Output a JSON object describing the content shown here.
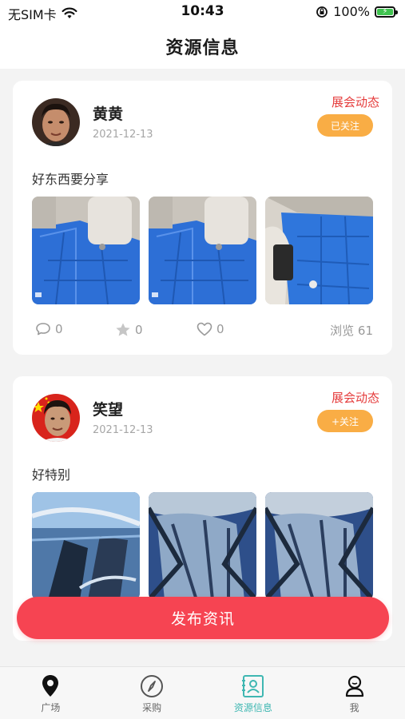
{
  "status_bar": {
    "carrier": "无SIM卡",
    "time": "10:43",
    "battery": "100%"
  },
  "nav": {
    "title": "资源信息"
  },
  "posts": [
    {
      "username": "黄黄",
      "date": "2021-12-13",
      "category": "展会动态",
      "follow_label": "已关注",
      "text": "好东西要分享",
      "comments": "0",
      "favorites": "0",
      "likes": "0",
      "views": "浏览 61"
    },
    {
      "username": "笑望",
      "date": "2021-12-13",
      "category": "展会动态",
      "follow_label": "+关注",
      "text": "好特别"
    }
  ],
  "publish_button": "发布资讯",
  "tabs": [
    {
      "label": "广场",
      "icon": "location-pin-icon"
    },
    {
      "label": "采购",
      "icon": "compass-icon"
    },
    {
      "label": "资源信息",
      "icon": "contact-card-icon"
    },
    {
      "label": "我",
      "icon": "profile-icon"
    }
  ],
  "colors": {
    "accent_red": "#f64452",
    "category_red": "#e53c3c",
    "follow_orange": "#f9ad45",
    "active_tab": "#3fb7b2"
  }
}
